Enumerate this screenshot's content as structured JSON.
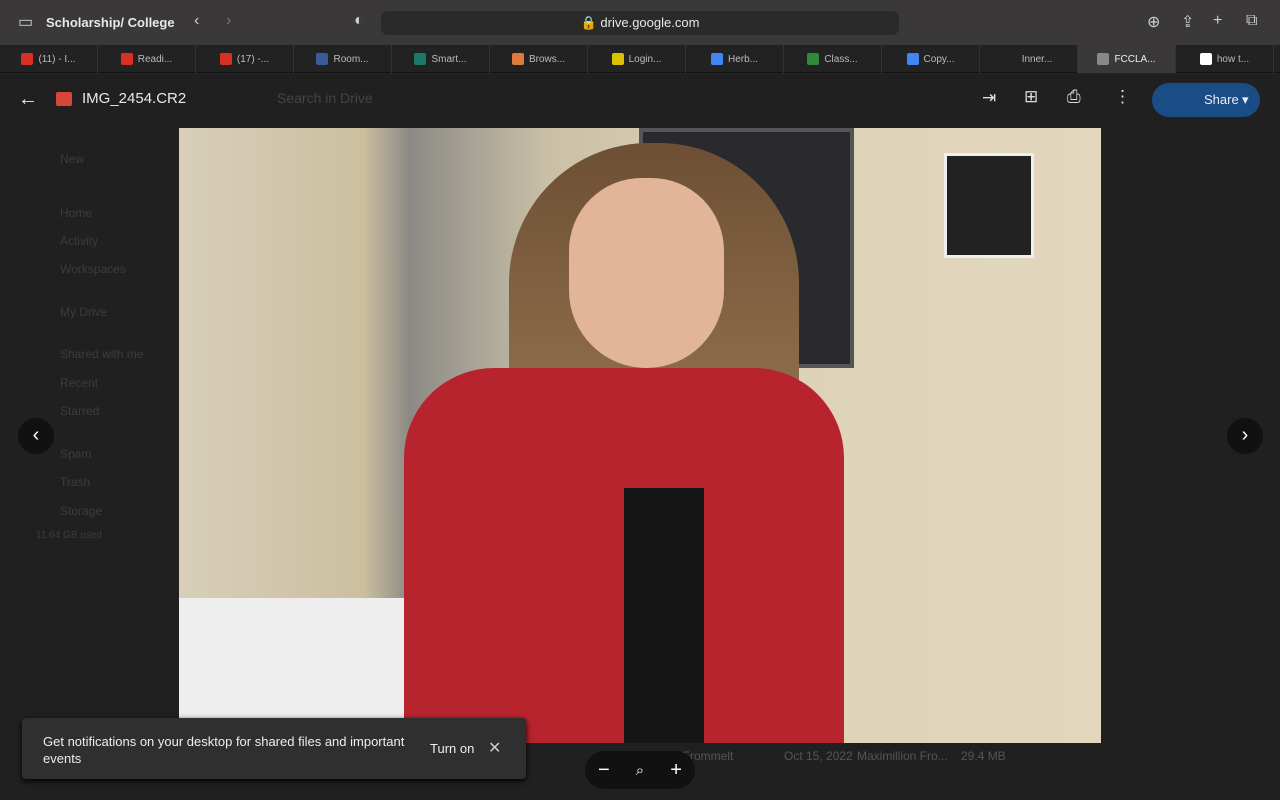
{
  "browser": {
    "tab_group": "Scholarship/ College",
    "url": "drive.google.com",
    "tabs": [
      {
        "label": "(11) - I...",
        "icon": "gmail",
        "color": "#d93025"
      },
      {
        "label": "Readi...",
        "icon": "gmail",
        "color": "#d93025"
      },
      {
        "label": "(17) -...",
        "icon": "gmail",
        "color": "#d93025"
      },
      {
        "label": "Room...",
        "icon": "p",
        "color": "#3a5a9a"
      },
      {
        "label": "Smart...",
        "icon": "s",
        "color": "#1b7a6a"
      },
      {
        "label": "Brows...",
        "icon": "p",
        "color": "#e07a3a"
      },
      {
        "label": "Login...",
        "icon": "star",
        "color": "#d9c200"
      },
      {
        "label": "Herb...",
        "icon": "docs",
        "color": "#4285f4"
      },
      {
        "label": "Class...",
        "icon": "classroom",
        "color": "#2d8a3a"
      },
      {
        "label": "Copy...",
        "icon": "docs",
        "color": "#4285f4"
      },
      {
        "label": "Inner...",
        "icon": "none",
        "color": "#232222"
      },
      {
        "label": "FCCLA...",
        "icon": "g",
        "color": "#888"
      },
      {
        "label": "how t...",
        "icon": "google",
        "color": "#fff"
      }
    ]
  },
  "viewer": {
    "file_name": "IMG_2454.CR2",
    "share_label": "Share"
  },
  "drive": {
    "search_placeholder": "Search in Drive",
    "new_label": "New",
    "sidebar": [
      "Home",
      "Activity",
      "Workspaces",
      "My Drive",
      "Shared with me",
      "Recent",
      "Starred",
      "Spam",
      "Trash",
      "Storage"
    ],
    "storage_used": "11.64 GB used",
    "row": {
      "owner": "Maximillion Frommelt",
      "date": "Oct 15, 2022",
      "modified_by": "Maximillion Fro...",
      "size": "29.4 MB"
    }
  },
  "toast": {
    "message": "Get notifications on your desktop for shared files and important events",
    "action": "Turn on"
  }
}
